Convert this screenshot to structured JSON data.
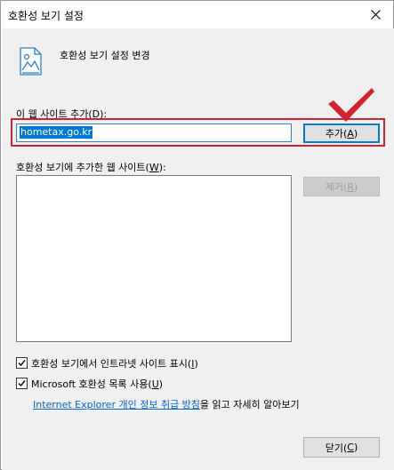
{
  "window": {
    "title": "호환성 보기 설정"
  },
  "header": {
    "text": "호환성 보기 설정 변경"
  },
  "add_site": {
    "label_prefix": "이 웹 사이트 추가(",
    "label_key": "D",
    "label_suffix": "):",
    "input_value": "hometax.go.kr",
    "button_prefix": "추가(",
    "button_key": "A",
    "button_suffix": ")"
  },
  "site_list": {
    "label_prefix": "호환성 보기에 추가한 웹 사이트(",
    "label_key": "W",
    "label_suffix": "):",
    "items": [],
    "remove_prefix": "제거(",
    "remove_key": "R",
    "remove_suffix": ")"
  },
  "options": {
    "intranet_prefix": "호환성 보기에서 인트라넷 사이트 표시(",
    "intranet_key": "I",
    "intranet_suffix": ")",
    "intranet_checked": true,
    "ms_list_prefix": "Microsoft 호환성 목록 사용(",
    "ms_list_key": "U",
    "ms_list_suffix": ")",
    "ms_list_checked": true
  },
  "privacy": {
    "link_text": "Internet Explorer 개인 정보 취급 방침",
    "trailing_text": "을 읽고 자세히 알아보기"
  },
  "footer": {
    "close_prefix": "닫기(",
    "close_key": "C",
    "close_suffix": ")"
  },
  "colors": {
    "highlight_box": "#d5232c",
    "selection": "#0078d7",
    "link": "#0066cc",
    "client_background": "#f0f0f0"
  },
  "icons": {
    "close": "close-icon",
    "page": "page-image-icon",
    "checkmark": "red-checkmark-icon"
  }
}
